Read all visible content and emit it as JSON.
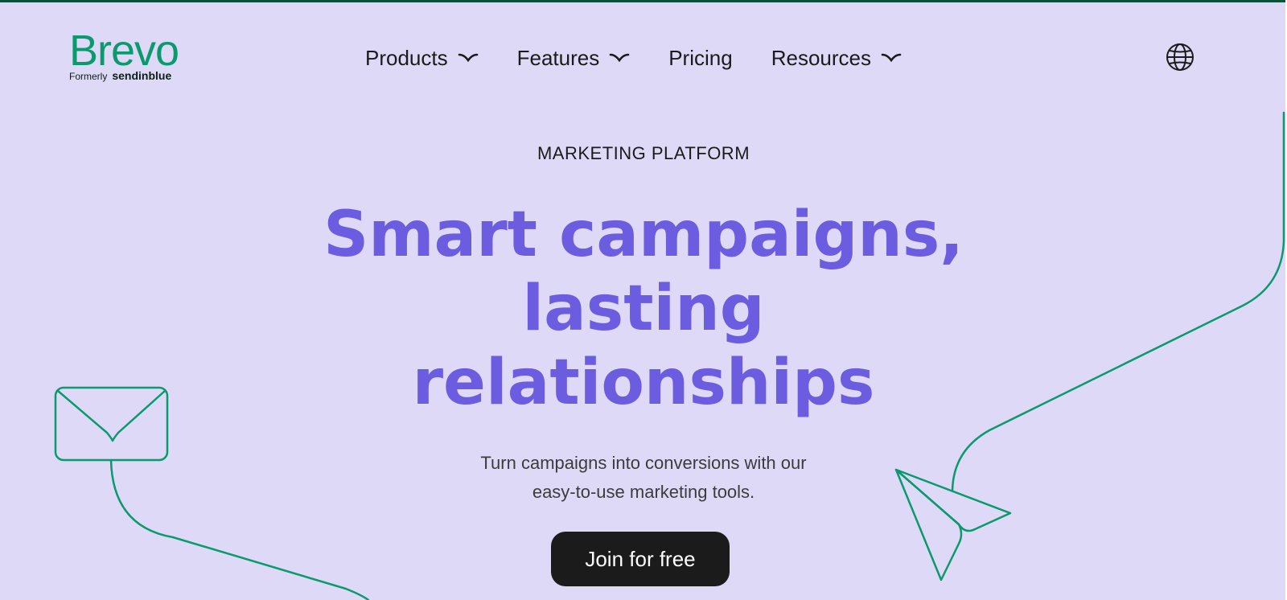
{
  "brand": {
    "name": "Brevo",
    "formerly_label": "Formerly",
    "former_name": "sendinblue",
    "color": "#0b996e"
  },
  "nav": {
    "items": [
      {
        "label": "Products",
        "has_dropdown": true
      },
      {
        "label": "Features",
        "has_dropdown": true
      },
      {
        "label": "Pricing",
        "has_dropdown": false
      },
      {
        "label": "Resources",
        "has_dropdown": true
      }
    ],
    "language_icon": "globe-icon"
  },
  "hero": {
    "eyebrow": "MARKETING PLATFORM",
    "headline_line1": "Smart campaigns,",
    "headline_line2": "lasting",
    "headline_line3": "relationships",
    "subtext_line1": "Turn campaigns into conversions with our",
    "subtext_line2": "easy-to-use marketing tools.",
    "cta_label": "Join for free"
  },
  "colors": {
    "background": "#ddd9f7",
    "headline": "#6b5ce0",
    "accent_line": "#0b996e",
    "cta_bg": "#1b1b1b"
  },
  "decorations": [
    "envelope-icon",
    "paper-plane-icon"
  ]
}
